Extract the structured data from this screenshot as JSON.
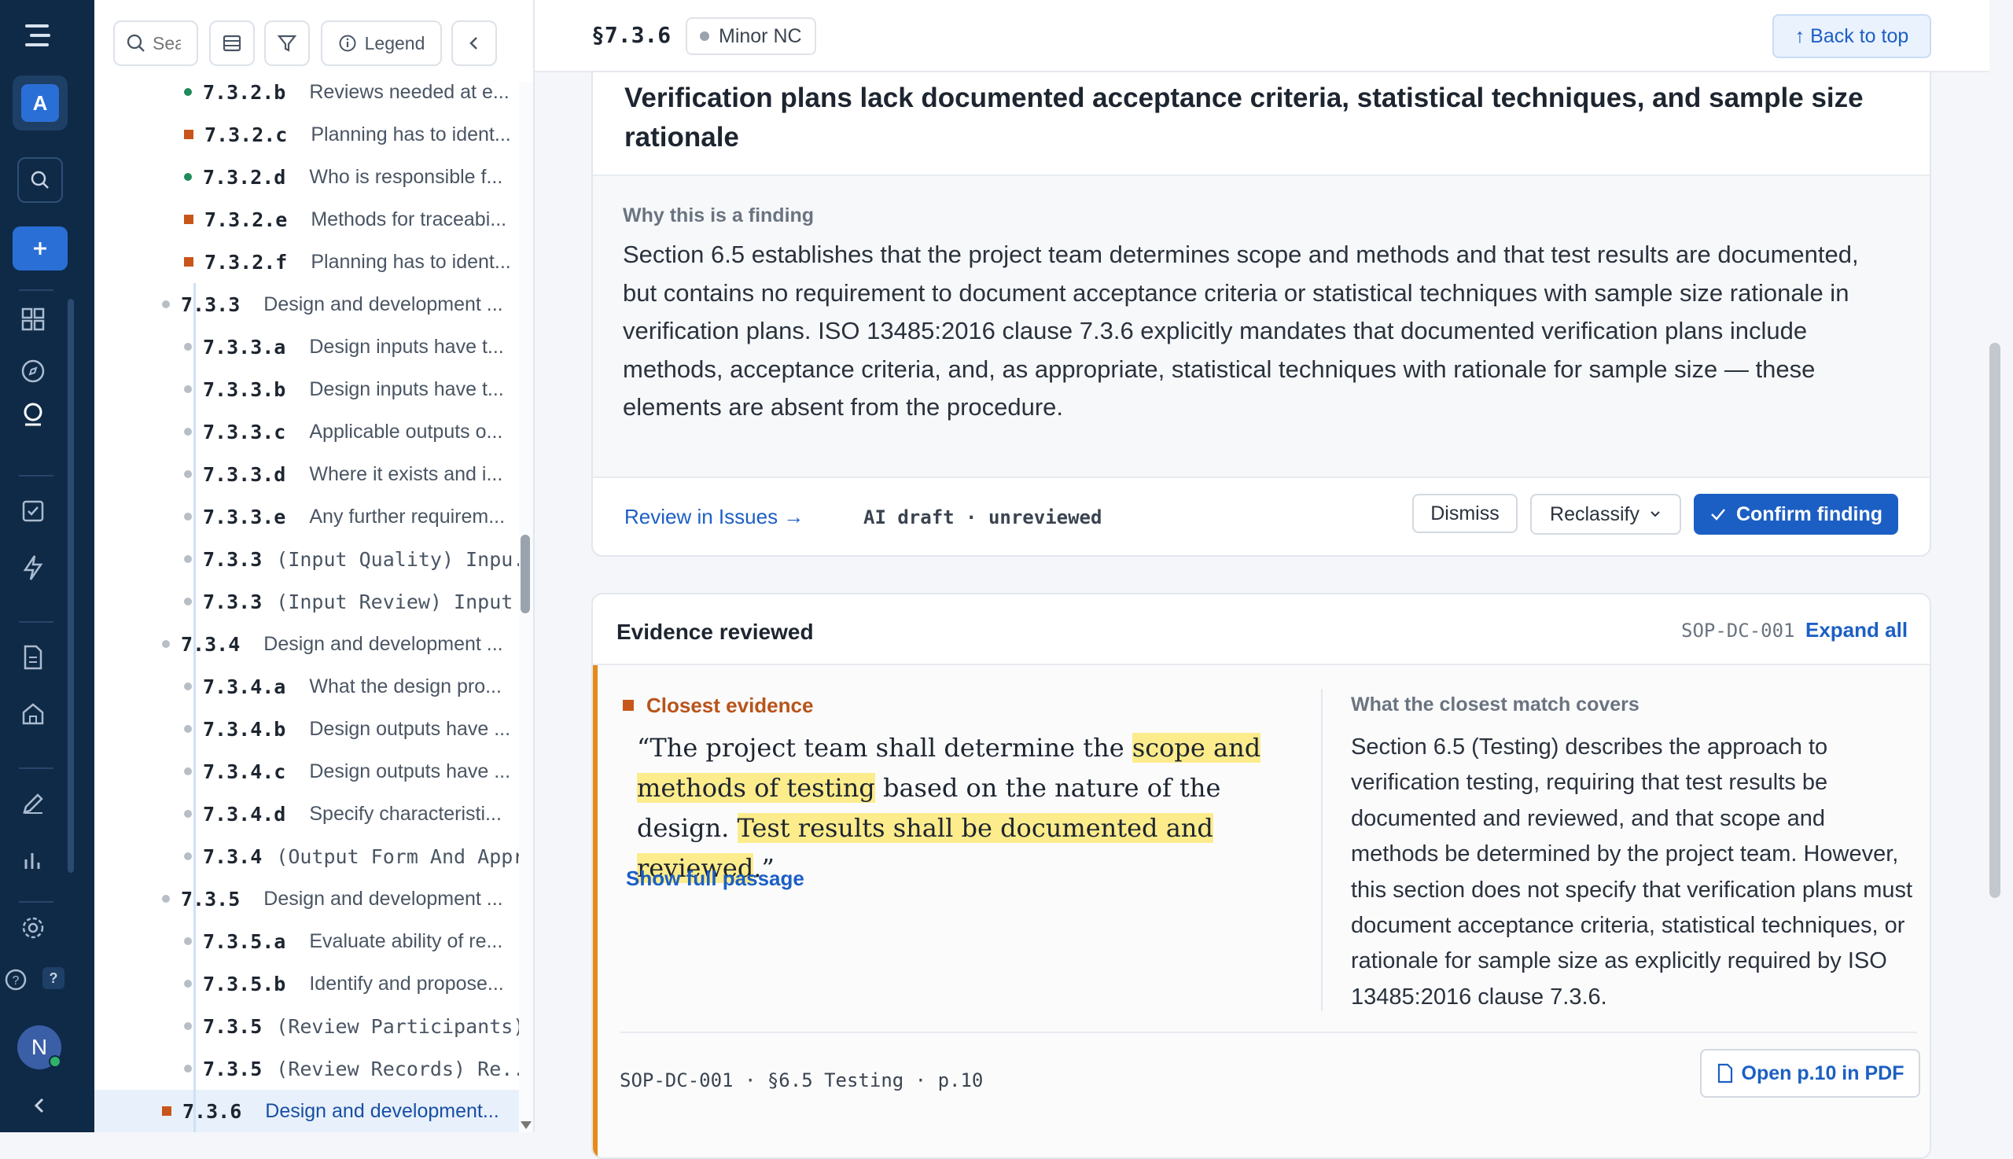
{
  "rail": {
    "workspace_letter": "A",
    "user_initial": "N",
    "help_badge": "?"
  },
  "tree_toolbar": {
    "search_placeholder": "Search",
    "legend_label": "Legend"
  },
  "tree": [
    {
      "code": "7.3.2.b",
      "label": "Reviews needed at e...",
      "marker": "dot",
      "color": "#1f8a5b"
    },
    {
      "code": "7.3.2.c",
      "label": "Planning has to ident...",
      "marker": "square",
      "color": "#c8561b"
    },
    {
      "code": "7.3.2.d",
      "label": "Who is responsible f...",
      "marker": "dot",
      "color": "#1f8a5b"
    },
    {
      "code": "7.3.2.e",
      "label": "Methods for traceabi...",
      "marker": "square",
      "color": "#c8561b"
    },
    {
      "code": "7.3.2.f",
      "label": "Planning has to ident...",
      "marker": "square",
      "color": "#c8561b"
    },
    {
      "code": "7.3.3",
      "label": "Design and development ...",
      "marker": "dot",
      "color": "#b8bec6"
    },
    {
      "code": "7.3.3.a",
      "label": "Design inputs have t...",
      "marker": "dot",
      "color": "#b8bec6"
    },
    {
      "code": "7.3.3.b",
      "label": "Design inputs have t...",
      "marker": "dot",
      "color": "#b8bec6"
    },
    {
      "code": "7.3.3.c",
      "label": "Applicable outputs o...",
      "marker": "dot",
      "color": "#b8bec6"
    },
    {
      "code": "7.3.3.d",
      "label": "Where it exists and i...",
      "marker": "dot",
      "color": "#b8bec6"
    },
    {
      "code": "7.3.3.e",
      "label": "Any further requirem...",
      "marker": "dot",
      "color": "#b8bec6"
    },
    {
      "code": "7.3.3",
      "label": "(Input Quality) Inpu...",
      "marker": "dot",
      "color": "#b8bec6"
    },
    {
      "code": "7.3.3",
      "label": "(Input Review) Input ...",
      "marker": "dot",
      "color": "#b8bec6"
    },
    {
      "code": "7.3.4",
      "label": "Design and development ...",
      "marker": "dot",
      "color": "#b8bec6"
    },
    {
      "code": "7.3.4.a",
      "label": "What the design pro...",
      "marker": "dot",
      "color": "#b8bec6"
    },
    {
      "code": "7.3.4.b",
      "label": "Design outputs have ...",
      "marker": "dot",
      "color": "#b8bec6"
    },
    {
      "code": "7.3.4.c",
      "label": "Design outputs have ...",
      "marker": "dot",
      "color": "#b8bec6"
    },
    {
      "code": "7.3.4.d",
      "label": "Specify characteristi...",
      "marker": "dot",
      "color": "#b8bec6"
    },
    {
      "code": "7.3.4",
      "label": "(Output Form And Appro",
      "marker": "dot",
      "color": "#b8bec6"
    },
    {
      "code": "7.3.5",
      "label": "Design and development ...",
      "marker": "dot",
      "color": "#b8bec6"
    },
    {
      "code": "7.3.5.a",
      "label": "Evaluate ability of re...",
      "marker": "dot",
      "color": "#b8bec6"
    },
    {
      "code": "7.3.5.b",
      "label": "Identify and propose...",
      "marker": "dot",
      "color": "#b8bec6"
    },
    {
      "code": "7.3.5",
      "label": "(Review Participants)",
      "marker": "dot",
      "color": "#b8bec6"
    },
    {
      "code": "7.3.5",
      "label": "(Review Records) Re...",
      "marker": "dot",
      "color": "#b8bec6"
    },
    {
      "code": "7.3.6",
      "label": "Design and development...",
      "marker": "square",
      "color": "#c8561b"
    }
  ],
  "topbar": {
    "section": "§7.3.6",
    "severity": "Minor NC",
    "back_to_top": "↑ Back to top"
  },
  "finding": {
    "title": "Verification plans lack documented acceptance criteria, statistical techniques, and sample size rationale",
    "why_heading": "Why this is a finding",
    "why_body": "Section 6.5 establishes that the project team determines scope and methods and that test results are documented, but contains no requirement to document acceptance criteria or statistical techniques with sample size rationale in verification plans. ISO 13485:2016 clause 7.3.6 explicitly mandates that documented verification plans include methods, acceptance criteria, and, as appropriate, statistical techniques with rationale for sample size — these elements are absent from the procedure.",
    "review_link": "Review in Issues →",
    "status": "AI draft · unreviewed",
    "dismiss": "Dismiss",
    "reclassify": "Reclassify",
    "confirm": "Confirm finding"
  },
  "evidence": {
    "heading": "Evidence reviewed",
    "doc_id": "SOP-DC-001",
    "expand_all": "Expand all",
    "closest_label": "Closest evidence",
    "quote_open": "“The project team shall determine the ",
    "quote_hl1": "scope and methods of testing",
    "quote_mid": " based on the nature of the design. ",
    "quote_hl2": "Test results shall be documented and reviewed",
    "quote_close": ".”",
    "show_full": "Show full passage",
    "covers_heading": "What the closest match covers",
    "covers_body": "Section 6.5 (Testing) describes the approach to verification testing, requiring that test results be documented and reviewed, and that scope and methods be determined by the project team. However, this section does not specify that verification plans must document acceptance criteria, statistical techniques, or rationale for sample size as explicitly required by ISO 13485:2016 clause 7.3.6.",
    "citation": "SOP-DC-001 · §6.5 Testing · p.10",
    "open_pdf": "Open p.10 in PDF"
  },
  "colors": {
    "rail_bg": "#0f2a47",
    "primary": "#1c5fc4",
    "minor_nc": "#c8561b",
    "highlight": "#fdec8c"
  }
}
